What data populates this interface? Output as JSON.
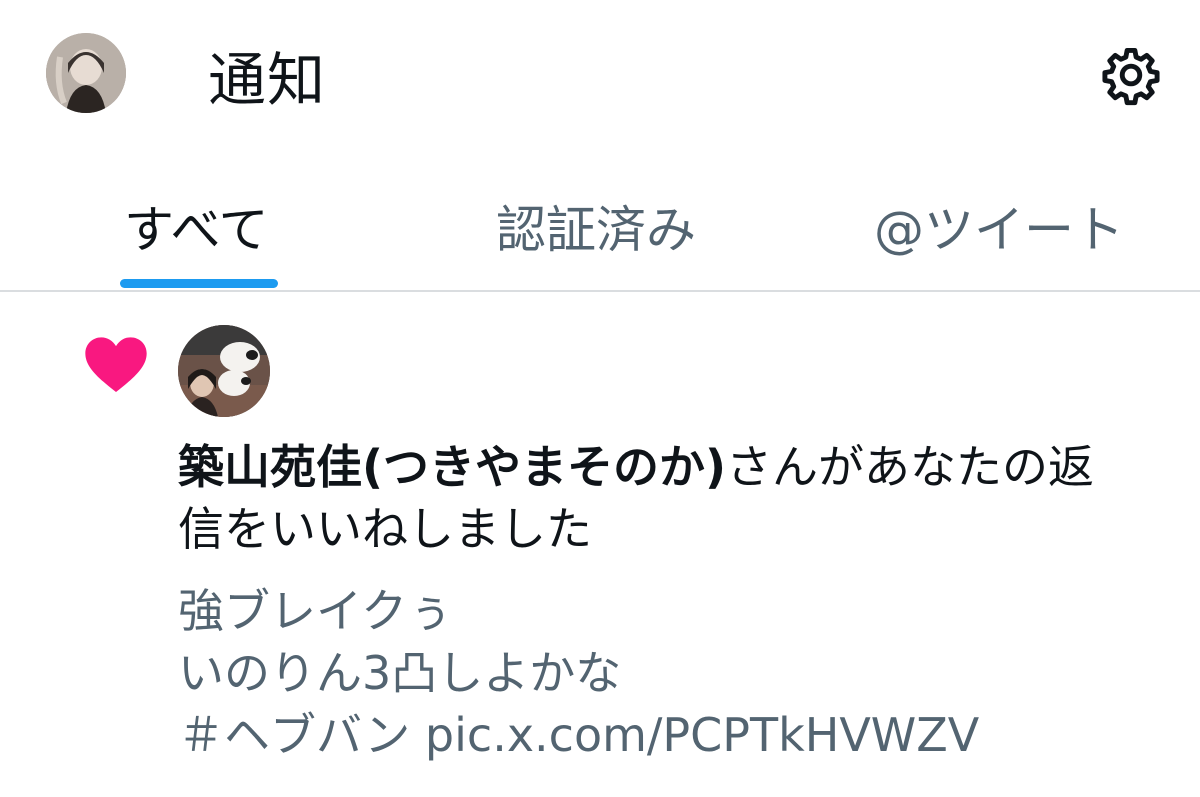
{
  "header": {
    "title": "通知",
    "avatar_icon": "user-avatar",
    "settings_icon": "gear-icon"
  },
  "tabs": [
    {
      "label": "すべて",
      "active": true
    },
    {
      "label": "認証済み",
      "active": false
    },
    {
      "label": "@ツイート",
      "active": false
    }
  ],
  "notification": {
    "type_icon": "heart-icon",
    "user_name": "築山苑佳(つきやまそのか)",
    "action_text": "さんがあなたの返信をいいねしました",
    "tweet_lines": [
      "強ブレイクぅ",
      "いのりん3凸しよかな",
      "＃ヘブバン pic.x.com/PCPTkHVWZV"
    ]
  },
  "colors": {
    "accent": "#1d9bf0",
    "heart": "#f91880",
    "text_primary": "#0f1419",
    "text_secondary": "#536471"
  }
}
